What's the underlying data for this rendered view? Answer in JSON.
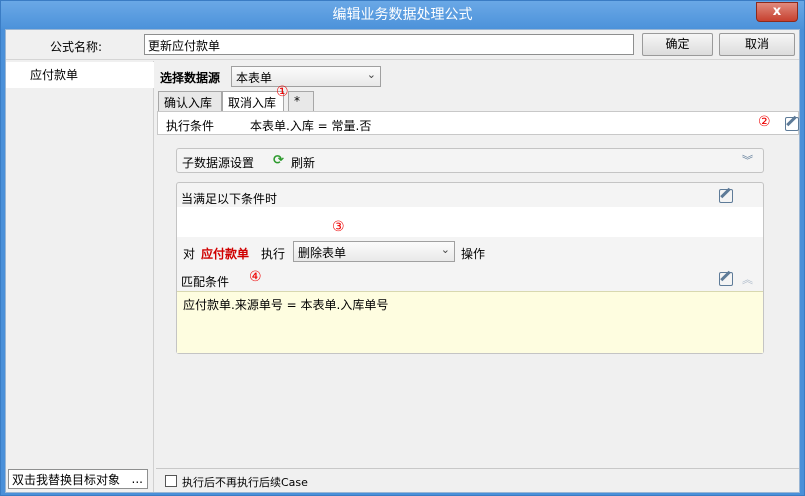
{
  "window": {
    "title": "编辑业务数据处理公式",
    "close": "x"
  },
  "form": {
    "name_label": "公式名称:",
    "name_value": "更新应付款单",
    "ok": "确定",
    "cancel": "取消"
  },
  "sidebar": {
    "items": [
      {
        "label": "应付款单"
      }
    ],
    "bottom_text": "双击我替换目标对象",
    "bottom_dots": "..."
  },
  "datasource": {
    "label": "选择数据源",
    "value": "本表单",
    "arrow": "⌄"
  },
  "tabs": [
    {
      "label": "确认入库"
    },
    {
      "label": "取消入库"
    },
    {
      "label": "*"
    }
  ],
  "markers": {
    "m1": "①",
    "m2": "②",
    "m3": "③",
    "m4": "④"
  },
  "execution": {
    "label": "执行条件",
    "value": "本表单.入库 = 常量.否"
  },
  "sub_ds": {
    "label": "子数据源设置",
    "refresh_icon": "⟳",
    "refresh_label": "刷新",
    "chevron": "︾"
  },
  "conditions": {
    "when_label": "当满足以下条件时",
    "op_prefix": "对",
    "target": "应付款单",
    "op_mid": "执行",
    "op_value": "删除表单",
    "op_suffix": "操作",
    "match_label": "匹配条件",
    "match_value": "应付款单.来源单号 = 本表单.入库单号",
    "up_chevron": "︽"
  },
  "footer": {
    "checkbox_label": "执行后不再执行后续Case"
  }
}
